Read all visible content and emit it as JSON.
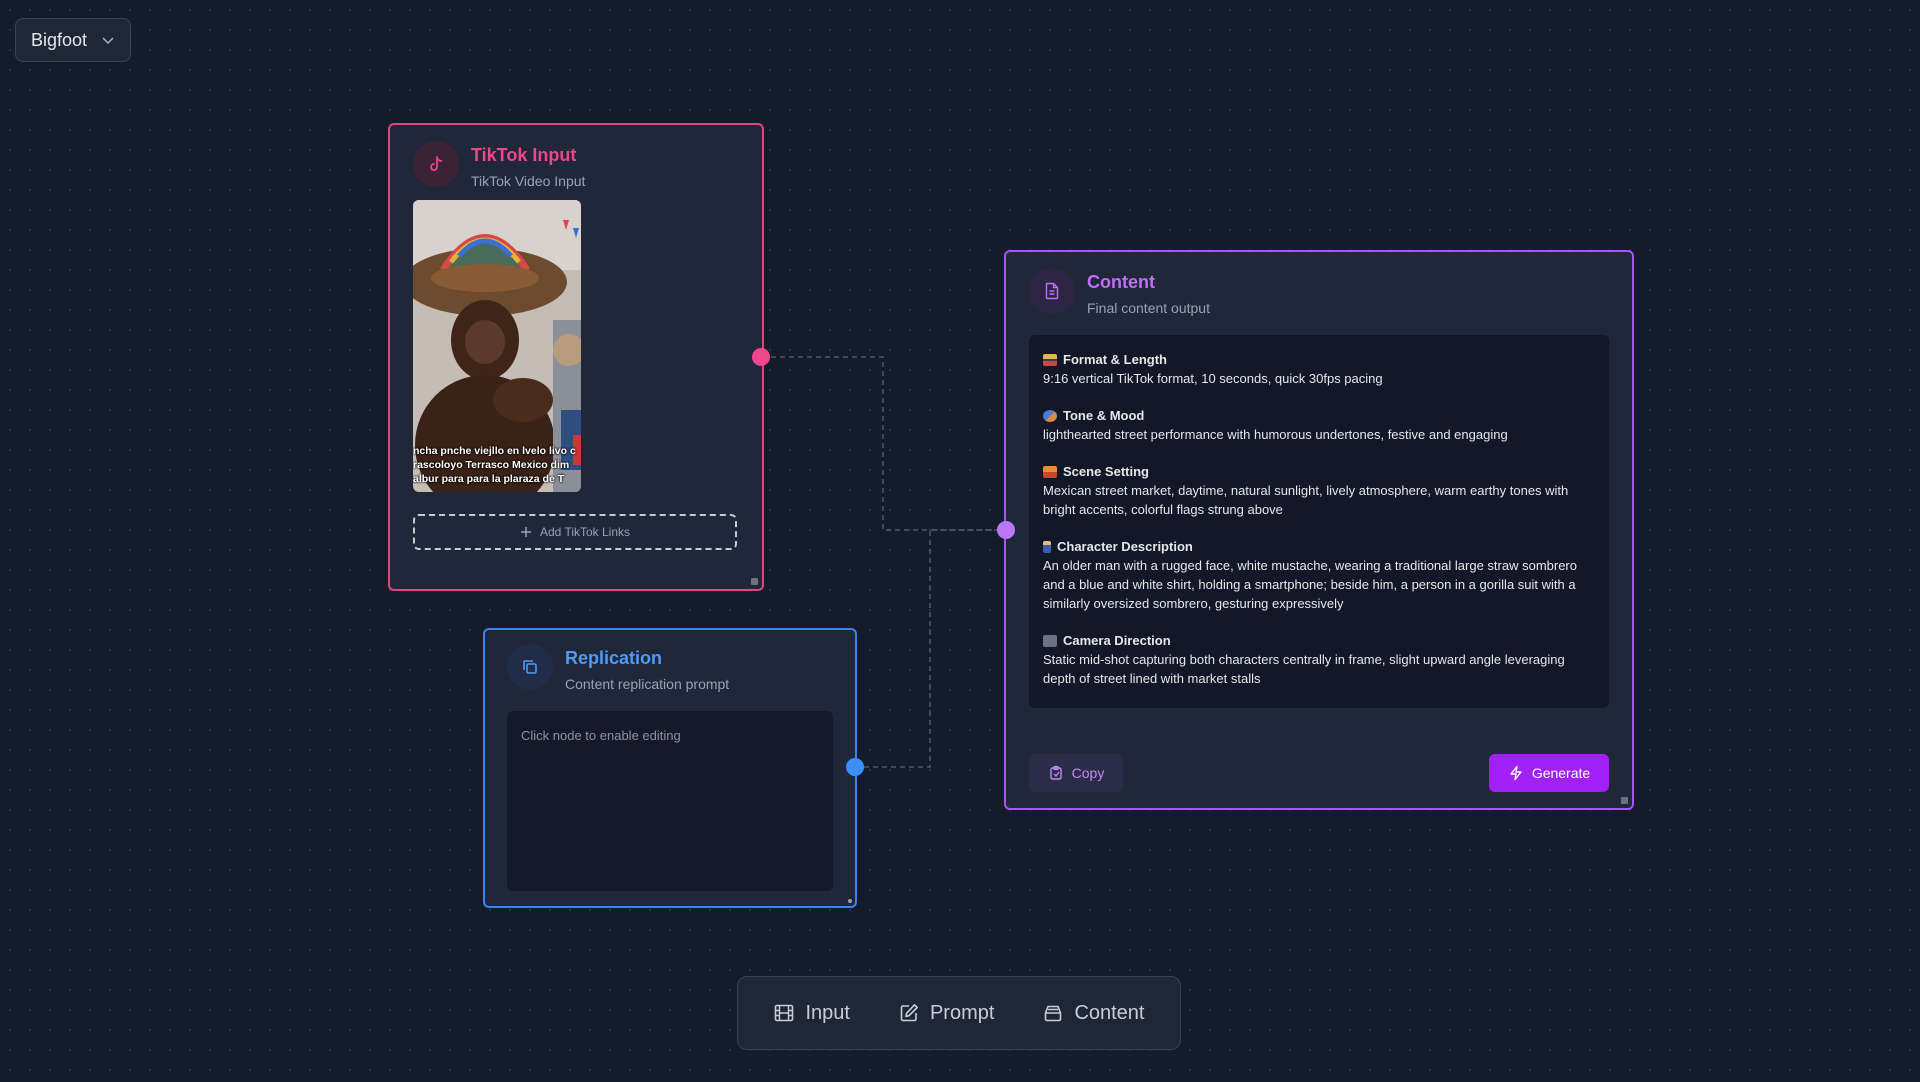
{
  "project": {
    "name": "Bigfoot"
  },
  "tiktok_node": {
    "title": "TikTok Input",
    "subtitle": "TikTok Video Input",
    "caption_lines": [
      "ncha pnche viejllo en lvelo livo c",
      "rascoloyo Terrasco Mexico dim",
      "albur para para la plaraza de T"
    ],
    "add_links_label": "Add TikTok Links"
  },
  "replication_node": {
    "title": "Replication",
    "subtitle": "Content replication prompt",
    "placeholder": "Click node to enable editing"
  },
  "content_node": {
    "title": "Content",
    "subtitle": "Final content output",
    "sections": [
      {
        "title": "Format & Length",
        "text": "9:16 vertical TikTok format, 10 seconds, quick 30fps pacing"
      },
      {
        "title": "Tone & Mood",
        "text": "lighthearted street performance with humorous undertones, festive and engaging"
      },
      {
        "title": "Scene Setting",
        "text": "Mexican street market, daytime, natural sunlight, lively atmosphere, warm earthy tones with bright accents, colorful flags strung above"
      },
      {
        "title": "Character Description",
        "text": "An older man with a rugged face, white mustache, wearing a traditional large straw sombrero and a blue and white shirt, holding a smartphone; beside him, a person in a gorilla suit with a similarly oversized sombrero, gesturing expressively"
      },
      {
        "title": "Camera Direction",
        "text": "Static mid-shot capturing both characters centrally in frame, slight upward angle leveraging depth of street lined with market stalls"
      }
    ],
    "copy_label": "Copy",
    "generate_label": "Generate"
  },
  "toolbar": {
    "input_label": "Input",
    "prompt_label": "Prompt",
    "content_label": "Content"
  },
  "colors": {
    "tiktok": "#e0457f",
    "replication": "#3b82f6",
    "content": "#a855f7"
  }
}
